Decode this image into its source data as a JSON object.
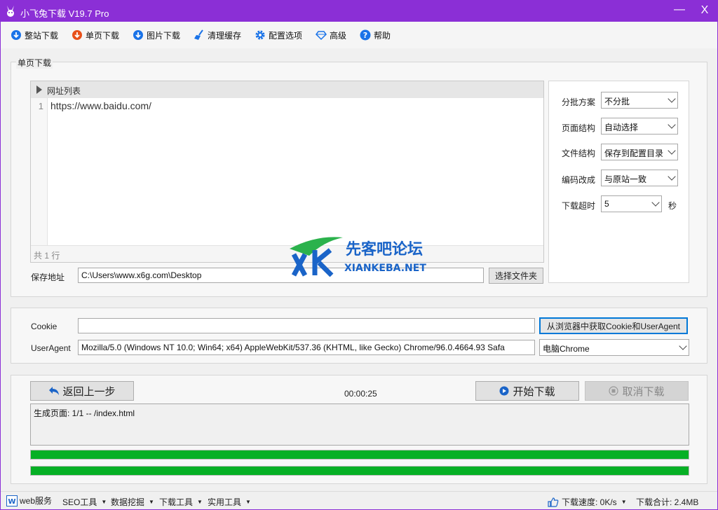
{
  "window": {
    "title": "小飞兔下载 V19.7 Pro",
    "minimize": "—",
    "close": "X"
  },
  "toolbar": {
    "items": [
      {
        "label": "整站下载",
        "icon": "download-icon",
        "color": "#1a73e8"
      },
      {
        "label": "单页下载",
        "icon": "download-icon",
        "color": "#e8501a"
      },
      {
        "label": "图片下载",
        "icon": "download-icon",
        "color": "#1a73e8"
      },
      {
        "label": "清理缓存",
        "icon": "broom-icon",
        "color": "#1a73e8"
      },
      {
        "label": "配置选项",
        "icon": "gear-icon",
        "color": "#1a73e8"
      },
      {
        "label": "高级",
        "icon": "diamond-icon",
        "color": "#1a73e8"
      },
      {
        "label": "帮助",
        "icon": "help-icon",
        "color": "#1a73e8"
      }
    ]
  },
  "group": {
    "label": "单页下载"
  },
  "url_list": {
    "header": "网址列表",
    "line_number": "1",
    "url": "https://www.baidu.com/",
    "footer": "共 1 行"
  },
  "save_path": {
    "label": "保存地址",
    "value": "C:\\Users\\www.x6g.com\\Desktop",
    "button": "选择文件夹"
  },
  "options": {
    "batch": {
      "label": "分批方案",
      "value": "不分批"
    },
    "page_structure": {
      "label": "页面结构",
      "value": "自动选择"
    },
    "file_structure": {
      "label": "文件结构",
      "value": "保存到配置目录"
    },
    "encoding": {
      "label": "编码改成",
      "value": "与原站一致"
    },
    "timeout": {
      "label": "下载超时",
      "value": "5",
      "unit": "秒"
    }
  },
  "cookie": {
    "label": "Cookie",
    "value": "",
    "button": "从浏览器中获取Cookie和UserAgent"
  },
  "useragent": {
    "label": "UserAgent",
    "value": "Mozilla/5.0 (Windows NT 10.0; Win64; x64) AppleWebKit/537.36 (KHTML, like Gecko) Chrome/96.0.4664.93 Safa",
    "browser": "电脑Chrome"
  },
  "actions": {
    "back": "返回上一步",
    "timer": "00:00:25",
    "start": "开始下载",
    "cancel": "取消下载"
  },
  "log": {
    "text": "生成页面: 1/1 -- /index.html"
  },
  "progress": {
    "bar1": 1.0,
    "bar2": 1.0
  },
  "watermark": {
    "cn": "先客吧论坛",
    "en": "XIANKEBA.NET"
  },
  "statusbar": {
    "web_service": "web服务",
    "seo": "SEO工具",
    "mining": "数据挖掘",
    "download_tools": "下载工具",
    "utilities": "实用工具",
    "speed": "下载速度: 0K/s",
    "total": "下载合计: 2.4MB"
  }
}
